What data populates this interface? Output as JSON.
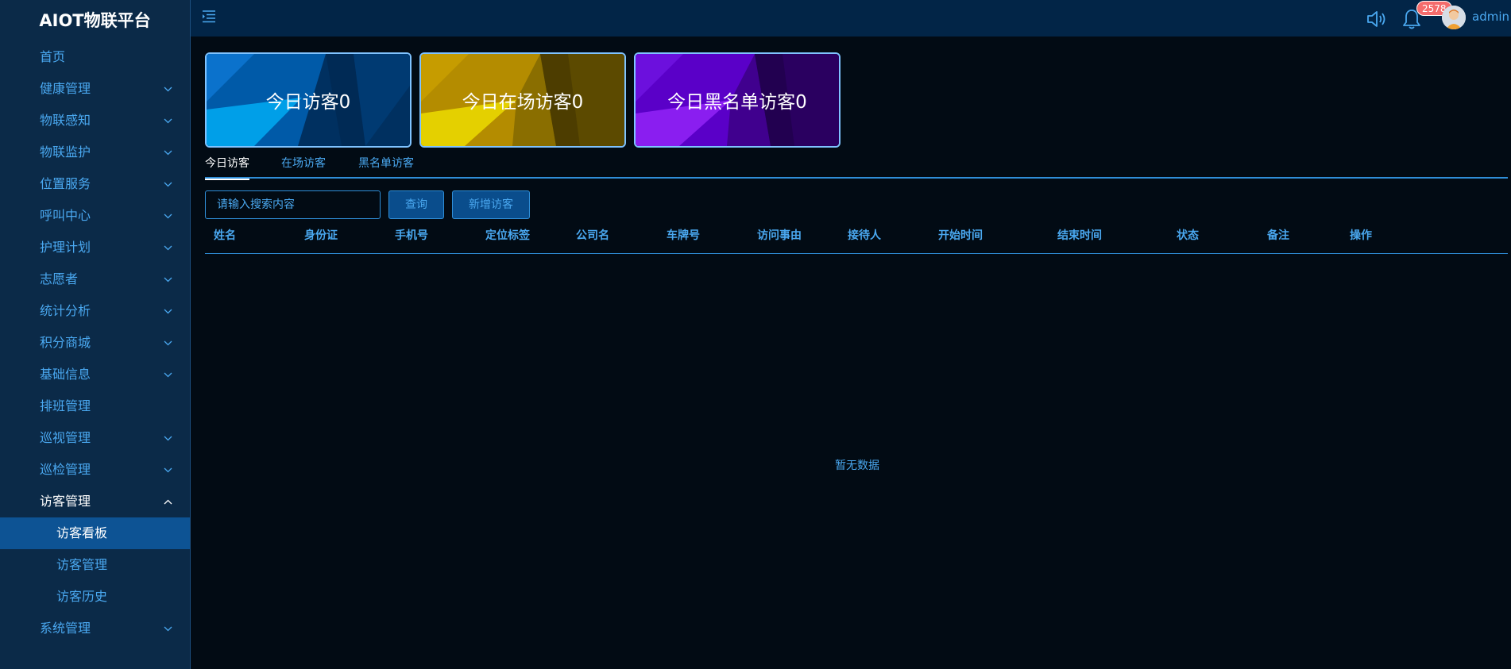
{
  "brand": "AIOT物联平台",
  "sidebar": {
    "items": [
      {
        "label": "首页"
      },
      {
        "label": "健康管理"
      },
      {
        "label": "物联感知"
      },
      {
        "label": "物联监护"
      },
      {
        "label": "位置服务"
      },
      {
        "label": "呼叫中心"
      },
      {
        "label": "护理计划"
      },
      {
        "label": "志愿者"
      },
      {
        "label": "统计分析"
      },
      {
        "label": "积分商城"
      },
      {
        "label": "基础信息"
      },
      {
        "label": "排班管理"
      },
      {
        "label": "巡视管理"
      },
      {
        "label": "巡检管理"
      },
      {
        "label": "访客管理"
      },
      {
        "label": "系统管理"
      }
    ],
    "submenu": [
      {
        "label": "访客看板"
      },
      {
        "label": "访客管理"
      },
      {
        "label": "访客历史"
      }
    ]
  },
  "header": {
    "notification_count": "2578",
    "username": "admin"
  },
  "cards": [
    {
      "label": "今日访客0",
      "color": "#0a6fc4"
    },
    {
      "label": "今日在场访客0",
      "color": "#c8a400"
    },
    {
      "label": "今日黑名单访客0",
      "color": "#6a0fd0"
    }
  ],
  "tabs": [
    {
      "label": "今日访客"
    },
    {
      "label": "在场访客"
    },
    {
      "label": "黑名单访客"
    }
  ],
  "search": {
    "placeholder": "请输入搜索内容",
    "query_label": "查询",
    "add_label": "新增访客"
  },
  "table": {
    "columns": [
      "姓名",
      "身份证",
      "手机号",
      "定位标签",
      "公司名",
      "车牌号",
      "访问事由",
      "接待人",
      "开始时间",
      "结束时间",
      "状态",
      "备注",
      "操作"
    ],
    "empty_text": "暂无数据"
  },
  "colors": {
    "sidebar_bg": "#0b2a48",
    "accent": "#4aa8f0",
    "badge": "#f56c6c",
    "active_menu": "#0d5394"
  }
}
